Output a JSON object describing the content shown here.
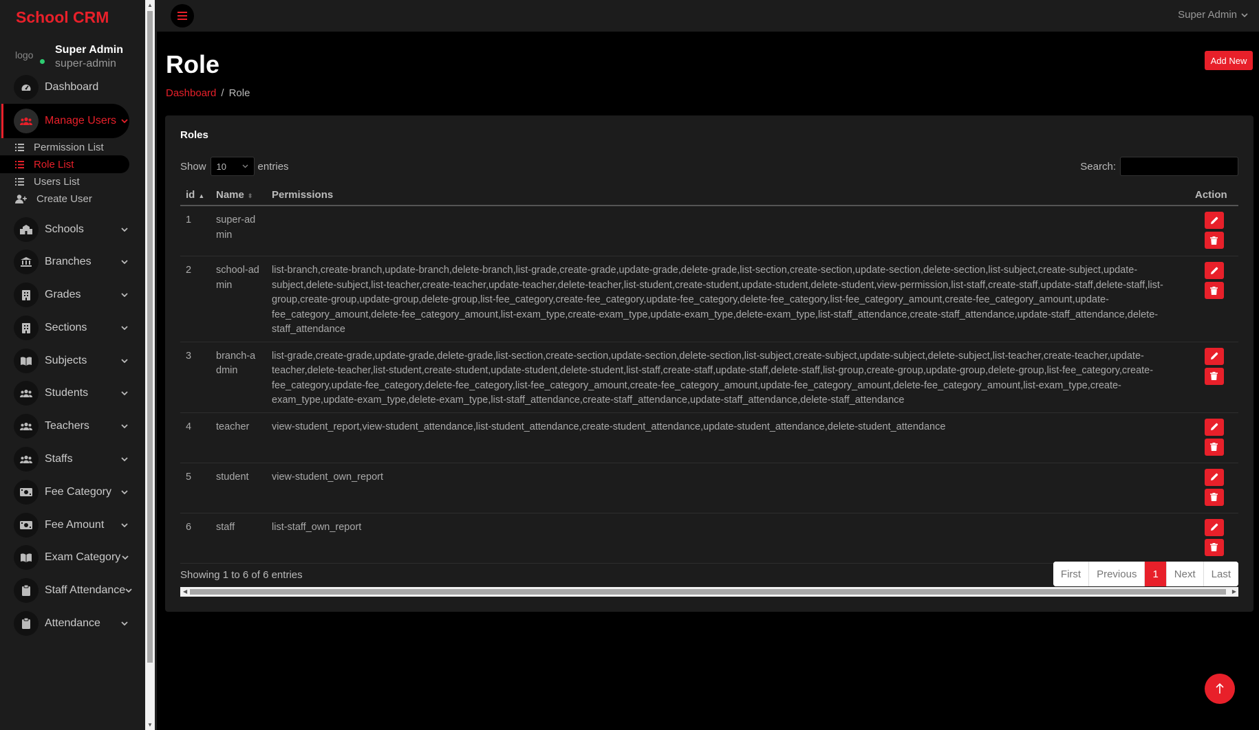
{
  "sidebar": {
    "brand": "School CRM",
    "user": {
      "name": "Super Admin",
      "role": "super-admin",
      "avatar_alt": "logo"
    },
    "items": [
      {
        "label": "Dashboard",
        "icon": "dashboard-icon",
        "chevron": false
      },
      {
        "label": "Manage Users",
        "icon": "users-icon",
        "chevron": true,
        "active": true
      },
      {
        "label": "Schools",
        "icon": "school-icon",
        "chevron": true
      },
      {
        "label": "Branches",
        "icon": "bank-icon",
        "chevron": true
      },
      {
        "label": "Grades",
        "icon": "building-icon",
        "chevron": true
      },
      {
        "label": "Sections",
        "icon": "building-icon",
        "chevron": true
      },
      {
        "label": "Subjects",
        "icon": "book-icon",
        "chevron": true
      },
      {
        "label": "Students",
        "icon": "users-icon",
        "chevron": true
      },
      {
        "label": "Teachers",
        "icon": "users-icon",
        "chevron": true
      },
      {
        "label": "Staffs",
        "icon": "users-icon",
        "chevron": true
      },
      {
        "label": "Fee Category",
        "icon": "money-icon",
        "chevron": true
      },
      {
        "label": "Fee Amount",
        "icon": "money-icon",
        "chevron": true
      },
      {
        "label": "Exam Category",
        "icon": "book-icon",
        "chevron": true
      },
      {
        "label": "Staff Attendance",
        "icon": "clipboard-icon",
        "chevron": true
      },
      {
        "label": "Attendance",
        "icon": "clipboard-icon",
        "chevron": true
      }
    ],
    "sub_items": [
      {
        "label": "Permission List",
        "icon": "list-icon"
      },
      {
        "label": "Role List",
        "icon": "list-icon",
        "active": true
      },
      {
        "label": "Users List",
        "icon": "list-icon"
      },
      {
        "label": "Create User",
        "icon": "user-plus-icon"
      }
    ]
  },
  "topbar": {
    "user": "Super Admin"
  },
  "page": {
    "title": "Role",
    "add_new": "Add New",
    "breadcrumb": {
      "home": "Dashboard",
      "sep": "/",
      "current": "Role"
    }
  },
  "card": {
    "title": "Roles",
    "show_label": "Show",
    "entries_value": "10",
    "entries_label": "entries",
    "search_label": "Search:",
    "columns": [
      "id",
      "Name",
      "Permissions",
      "Action"
    ],
    "rows": [
      {
        "id": "1",
        "name": "super-admin",
        "permissions": ""
      },
      {
        "id": "2",
        "name": "school-admin",
        "permissions": "list-branch,create-branch,update-branch,delete-branch,list-grade,create-grade,update-grade,delete-grade,list-section,create-section,update-section,delete-section,list-subject,create-subject,update-subject,delete-subject,list-teacher,create-teacher,update-teacher,delete-teacher,list-student,create-student,update-student,delete-student,view-permission,list-staff,create-staff,update-staff,delete-staff,list-group,create-group,update-group,delete-group,list-fee_category,create-fee_category,update-fee_category,delete-fee_category,list-fee_category_amount,create-fee_category_amount,update-fee_category_amount,delete-fee_category_amount,list-exam_type,create-exam_type,update-exam_type,delete-exam_type,list-staff_attendance,create-staff_attendance,update-staff_attendance,delete-staff_attendance"
      },
      {
        "id": "3",
        "name": "branch-admin",
        "permissions": "list-grade,create-grade,update-grade,delete-grade,list-section,create-section,update-section,delete-section,list-subject,create-subject,update-subject,delete-subject,list-teacher,create-teacher,update-teacher,delete-teacher,list-student,create-student,update-student,delete-student,list-staff,create-staff,update-staff,delete-staff,list-group,create-group,update-group,delete-group,list-fee_category,create-fee_category,update-fee_category,delete-fee_category,list-fee_category_amount,create-fee_category_amount,update-fee_category_amount,delete-fee_category_amount,list-exam_type,create-exam_type,update-exam_type,delete-exam_type,list-staff_attendance,create-staff_attendance,update-staff_attendance,delete-staff_attendance"
      },
      {
        "id": "4",
        "name": "teacher",
        "permissions": "view-student_report,view-student_attendance,list-student_attendance,create-student_attendance,update-student_attendance,delete-student_attendance"
      },
      {
        "id": "5",
        "name": "student",
        "permissions": "view-student_own_report"
      },
      {
        "id": "6",
        "name": "staff",
        "permissions": "list-staff_own_report"
      }
    ],
    "footer": "Showing 1 to 6 of 6 entries",
    "pagination": [
      "First",
      "Previous",
      "1",
      "Next",
      "Last"
    ],
    "current_page": "1"
  },
  "colors": {
    "accent": "#e8202a",
    "background": "#000000",
    "panel": "#1c1c1c"
  }
}
